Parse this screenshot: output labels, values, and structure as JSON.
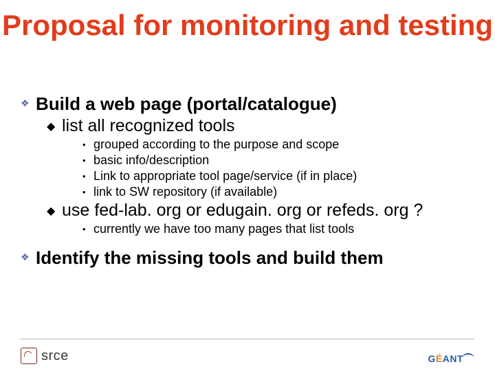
{
  "slide": {
    "title": "Proposal for monitoring and testing",
    "items": [
      {
        "text": "Build a web page (portal/catalogue)",
        "children": [
          {
            "text": "list all recognized tools",
            "children": [
              {
                "text": "grouped according to the purpose and scope"
              },
              {
                "text": "basic info/description"
              },
              {
                "text": "Link to appropriate tool page/service (if in place)"
              },
              {
                "text": "link to SW repository (if available)"
              }
            ]
          },
          {
            "text": "use fed-lab. org or edugain. org or refeds. org ?",
            "children": [
              {
                "text": "currently we have too many pages that list tools"
              }
            ]
          }
        ]
      },
      {
        "text": "Identify the missing tools and build them"
      }
    ]
  },
  "footer": {
    "left_logo_text": "srce",
    "right_logo_text_1": "G",
    "right_logo_text_2": "É",
    "right_logo_text_3": "ANT"
  }
}
